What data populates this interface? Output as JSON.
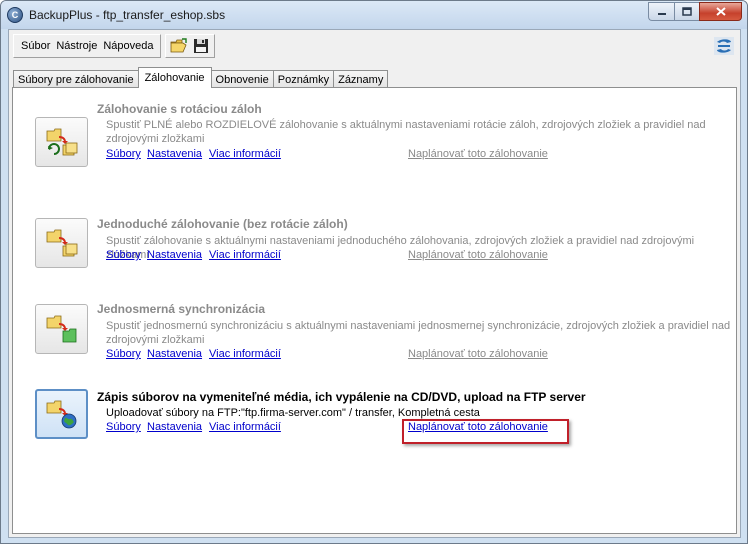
{
  "window": {
    "title": "BackupPlus - ftp_transfer_eshop.sbs",
    "app_icon_glyph": "C"
  },
  "menu": {
    "items": [
      "Súbor",
      "Nástroje",
      "Nápoveda"
    ]
  },
  "toolbar": {
    "icons": [
      "open-folder-icon",
      "save-disk-icon"
    ]
  },
  "tabs": [
    {
      "label": "Súbory pre zálohovanie",
      "active": false
    },
    {
      "label": "Zálohovanie",
      "active": true
    },
    {
      "label": "Obnovenie",
      "active": false
    },
    {
      "label": "Poznámky",
      "active": false
    },
    {
      "label": "Záznamy",
      "active": false
    }
  ],
  "backups": [
    {
      "title": "Zálohovanie s rotáciou záloh",
      "description": "Spustiť PLNÉ alebo ROZDIELOVÉ zálohovanie s aktuálnymi nastaveniami rotácie záloh, zdrojových zložiek a pravidiel nad zdrojovými zložkami",
      "links": {
        "files": "Súbory",
        "settings": "Nastavenia",
        "more": "Viac informácií",
        "schedule": "Naplánovať toto zálohovanie"
      }
    },
    {
      "title": "Jednoduché zálohovanie (bez rotácie záloh)",
      "description": "Spustiť zálohovanie s aktuálnymi nastaveniami jednoduchého zálohovania, zdrojových zložiek a pravidiel nad zdrojovými zložkami",
      "links": {
        "files": "Súbory",
        "settings": "Nastavenia",
        "more": "Viac informácií",
        "schedule": "Naplánovať toto zálohovanie"
      }
    },
    {
      "title": "Jednosmerná synchronizácia",
      "description": "Spustiť jednosmernú synchronizáciu s aktuálnymi nastaveniami jednosmernej synchronizácie, zdrojových zložiek a pravidiel nad zdrojovými zložkami",
      "links": {
        "files": "Súbory",
        "settings": "Nastavenia",
        "more": "Viac informácií",
        "schedule": "Naplánovať toto zálohovanie"
      }
    },
    {
      "title": "Zápis súborov na vymeniteľné média, ich vypálenie na CD/DVD, upload na FTP server",
      "description": "Uploadovať súbory na FTP:\"ftp.firma-server.com\" / transfer, Kompletná cesta",
      "links": {
        "files": "Súbory",
        "settings": "Nastavenia",
        "more": "Viac informácií",
        "schedule": "Naplánovať toto zálohovanie"
      }
    }
  ],
  "colors": {
    "link": "#0000cc",
    "disabled_text": "#8a8a8a",
    "highlight": "#c0202a"
  }
}
